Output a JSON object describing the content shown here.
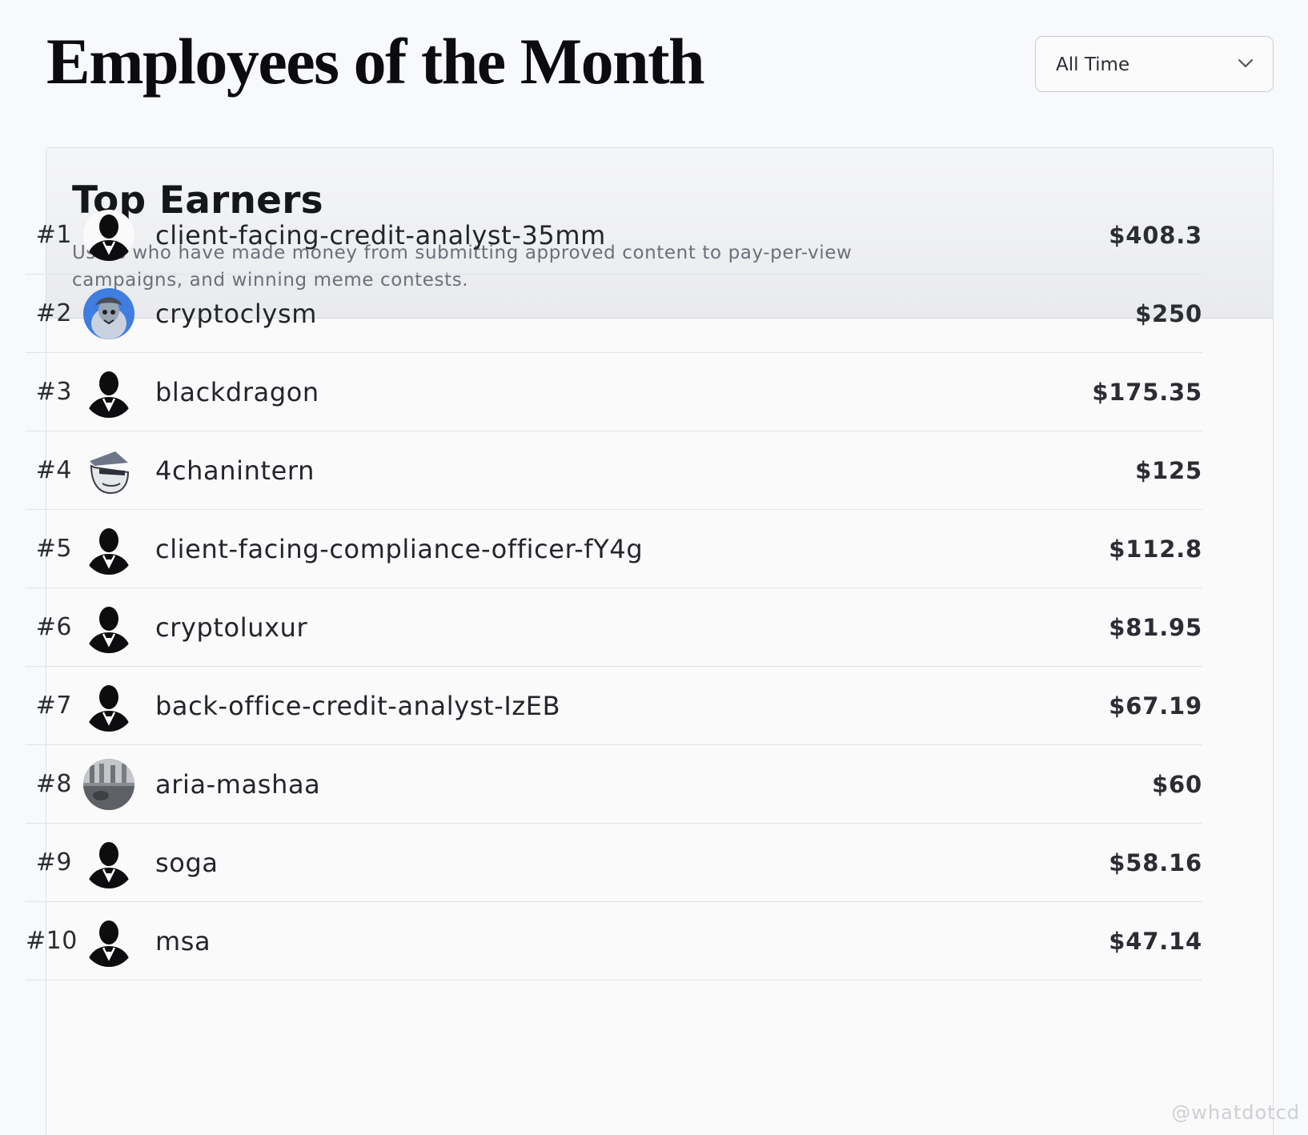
{
  "page": {
    "title": "Employees of the Month"
  },
  "filter": {
    "selected": "All Time",
    "icon": "chevron-down-icon"
  },
  "leaderboard": {
    "title": "Top Earners",
    "description": "Users who have made money from submitting approved content to pay-per-view campaigns, and winning meme contests.",
    "rows": [
      {
        "rank": "#1",
        "username": "client-facing-credit-analyst-35mm",
        "amount": "$408.3",
        "avatar": "silhouette"
      },
      {
        "rank": "#2",
        "username": "cryptoclysm",
        "amount": "$250",
        "avatar": "cryptoclysm"
      },
      {
        "rank": "#3",
        "username": "blackdragon",
        "amount": "$175.35",
        "avatar": "silhouette"
      },
      {
        "rank": "#4",
        "username": "4chanintern",
        "amount": "$125",
        "avatar": "4chanintern"
      },
      {
        "rank": "#5",
        "username": "client-facing-compliance-officer-fY4g",
        "amount": "$112.8",
        "avatar": "silhouette"
      },
      {
        "rank": "#6",
        "username": "cryptoluxur",
        "amount": "$81.95",
        "avatar": "silhouette"
      },
      {
        "rank": "#7",
        "username": "back-office-credit-analyst-IzEB",
        "amount": "$67.19",
        "avatar": "silhouette"
      },
      {
        "rank": "#8",
        "username": "aria-mashaa",
        "amount": "$60",
        "avatar": "aria-mashaa"
      },
      {
        "rank": "#9",
        "username": "soga",
        "amount": "$58.16",
        "avatar": "silhouette"
      },
      {
        "rank": "#10",
        "username": "msa",
        "amount": "$47.14",
        "avatar": "silhouette"
      }
    ]
  },
  "watermark": "@whatdotcd"
}
